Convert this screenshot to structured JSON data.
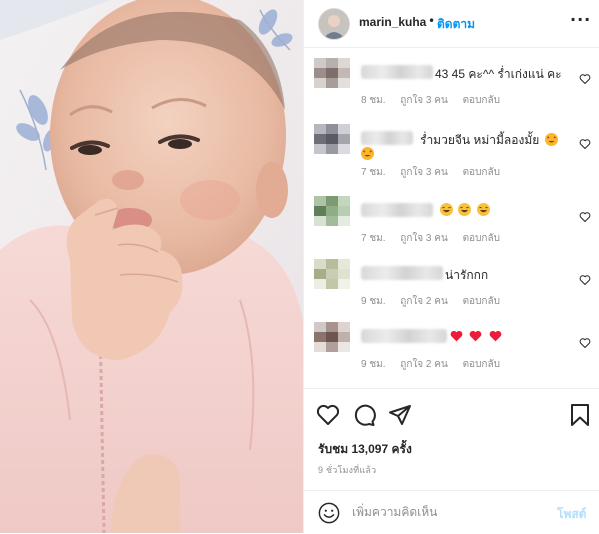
{
  "header": {
    "username": "marin_kuha",
    "separator": "•",
    "follow_label": "ติดตาม",
    "more_label": "···"
  },
  "comments": [
    {
      "text": "43 45 คะ^^ ร่ำเก่งแน่ คะ",
      "time": "8 ชม.",
      "likes": "ถูกใจ 3 คน",
      "reply": "ตอบกลับ"
    },
    {
      "text": "ร่ำมวยจีน หม่ามี้ลองมั้ย",
      "time": "7 ชม.",
      "likes": "ถูกใจ 3 คน",
      "reply": "ตอบกลับ"
    },
    {
      "text": "",
      "time": "7 ชม.",
      "likes": "ถูกใจ 3 คน",
      "reply": "ตอบกลับ"
    },
    {
      "text": "น่ารักกก",
      "time": "9 ชม.",
      "likes": "ถูกใจ 2 คน",
      "reply": "ตอบกลับ"
    },
    {
      "text": "",
      "time": "9 ชม.",
      "likes": "ถูกใจ 2 คน",
      "reply": "ตอบกลับ"
    }
  ],
  "actions": {
    "icons": [
      "heart-outline-icon",
      "comment-bubble-icon",
      "share-paper-plane-icon",
      "bookmark-icon"
    ]
  },
  "views": "รับชม 13,097 ครั้ง",
  "time_ago": "9 ชั่วโมงที่แล้ว",
  "add_comment": {
    "placeholder": "เพิ่มความคิดเห็น",
    "post_label": "โพสต์"
  },
  "colors": {
    "accent": "#0095f6",
    "post_disabled": "#b2dffc",
    "text_primary": "#262626",
    "text_secondary": "#8e8e8e",
    "heart_red": "#ed4956"
  }
}
